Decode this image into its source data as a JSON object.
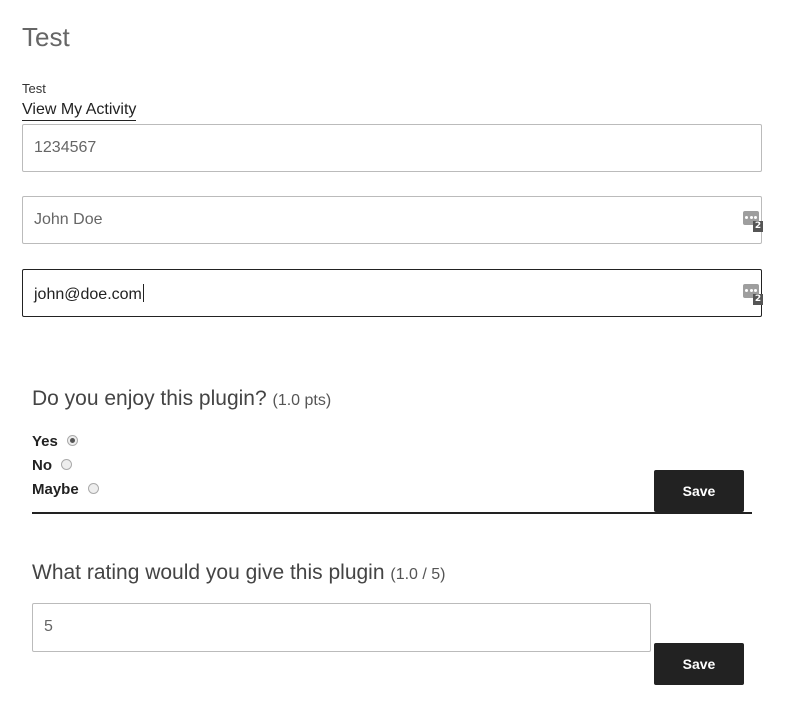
{
  "page": {
    "title": "Test",
    "label": "Test",
    "activity_link": "View My Activity"
  },
  "fields": {
    "number": {
      "value": "1234567"
    },
    "name": {
      "value": "John Doe",
      "badge": "2",
      "icon": "password-manager-icon"
    },
    "email": {
      "value": "john@doe.com",
      "badge": "2",
      "icon": "password-manager-icon"
    }
  },
  "question1": {
    "text": "Do you enjoy this plugin?",
    "meta": "(1.0 pts)",
    "options": [
      {
        "label": "Yes",
        "checked": true
      },
      {
        "label": "No",
        "checked": false
      },
      {
        "label": "Maybe",
        "checked": false
      }
    ],
    "save_label": "Save"
  },
  "question2": {
    "text": "What rating would you give this plugin",
    "meta": "(1.0 / 5)",
    "value": "5",
    "save_label": "Save"
  }
}
